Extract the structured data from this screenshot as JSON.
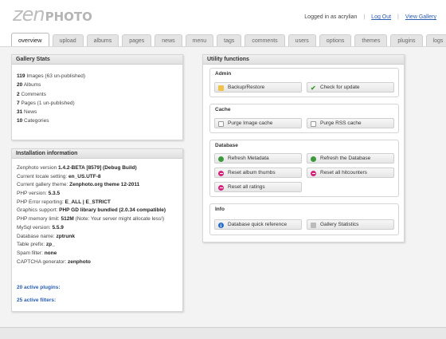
{
  "header": {
    "logo_left": "zen",
    "logo_right": "PHOTO",
    "logged_in": "Logged in as acrylian",
    "logout": "Log Out",
    "view_gallery": "View Gallery",
    "separator": "|"
  },
  "tabs": [
    "overview",
    "upload",
    "albums",
    "pages",
    "news",
    "menu",
    "tags",
    "comments",
    "users",
    "options",
    "themes",
    "plugins",
    "logs"
  ],
  "gallery_stats": {
    "title": "Gallery Stats",
    "rows": [
      {
        "num": "119",
        "label": "Images (63 un-published)"
      },
      {
        "num": "20",
        "label": "Albums"
      },
      {
        "num": "2",
        "label": "Comments"
      },
      {
        "num": "7",
        "label": "Pages (1 un-published)"
      },
      {
        "num": "31",
        "label": "News"
      },
      {
        "num": "10",
        "label": "Categories"
      }
    ]
  },
  "install_info": {
    "title": "Installation information",
    "rows": [
      {
        "label": "Zenphoto version ",
        "value": "1.4.2-BETA [8579] (Debug Build)"
      },
      {
        "label": "Current locale setting: ",
        "value": "en_US.UTF-8"
      },
      {
        "label": "Current gallery theme: ",
        "value": "Zenphoto.org theme 12-2011"
      },
      {
        "label": "PHP version: ",
        "value": "5.3.5"
      },
      {
        "label": "PHP Error reporting: ",
        "value": "E_ALL | E_STRICT"
      },
      {
        "label": "Graphics support: ",
        "value": "PHP GD library bundled (2.0.34 compatible)"
      },
      {
        "label": "PHP memory limit: ",
        "value": "512M",
        "note": " (Note: Your server might allocate less!)"
      },
      {
        "label": "MySql version: ",
        "value": "5.5.9"
      },
      {
        "label": "Database name: ",
        "value": "zptrunk"
      },
      {
        "label": "Table prefix: ",
        "value": "zp_"
      },
      {
        "label": "Spam filter: ",
        "value": "none"
      },
      {
        "label": "CAPTCHA generator: ",
        "value": "zenphoto"
      }
    ],
    "plugins_link": "20 active plugins:",
    "filters_link": "25 active filters:"
  },
  "utility": {
    "title": "Utility functions",
    "admin": {
      "title": "Admin",
      "backup": "Backup/Restore",
      "check_update": "Check for update"
    },
    "cache": {
      "title": "Cache",
      "purge_image": "Purge Image cache",
      "purge_rss": "Purge RSS cache"
    },
    "database": {
      "title": "Database",
      "refresh_metadata": "Refresh Metadata",
      "refresh_db": "Refresh the Database",
      "reset_album_thumbs": "Reset album thumbs",
      "reset_hitcounters": "Reset all hitcounters",
      "reset_ratings": "Reset all ratings"
    },
    "info": {
      "title": "Info",
      "db_reference": "Database quick reference",
      "gallery_stats": "Gallery Statistics"
    }
  },
  "colors": {
    "link": "#2a5db0",
    "accent_green": "#3c9a3c",
    "accent_magenta": "#d3247f",
    "accent_blue": "#2a6bc9"
  }
}
